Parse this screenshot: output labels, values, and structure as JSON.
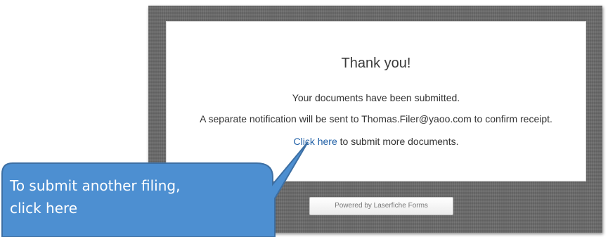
{
  "confirmation": {
    "title": "Thank you!",
    "line1": "Your documents have been submitted.",
    "line2": "A separate notification will be sent to Thomas.Filer@yaoo.com to confirm receipt.",
    "link_text": "Click here",
    "link_suffix": " to submit more documents."
  },
  "footer": {
    "powered_by": "Powered by Laserfiche Forms"
  },
  "callout": {
    "line1": "To submit another filing,",
    "line2": "click here",
    "fill_color": "#4d8fd1",
    "border_color": "#3d6fa3"
  },
  "colors": {
    "link": "#1f5fa6",
    "frame": "#6b6b6b"
  }
}
